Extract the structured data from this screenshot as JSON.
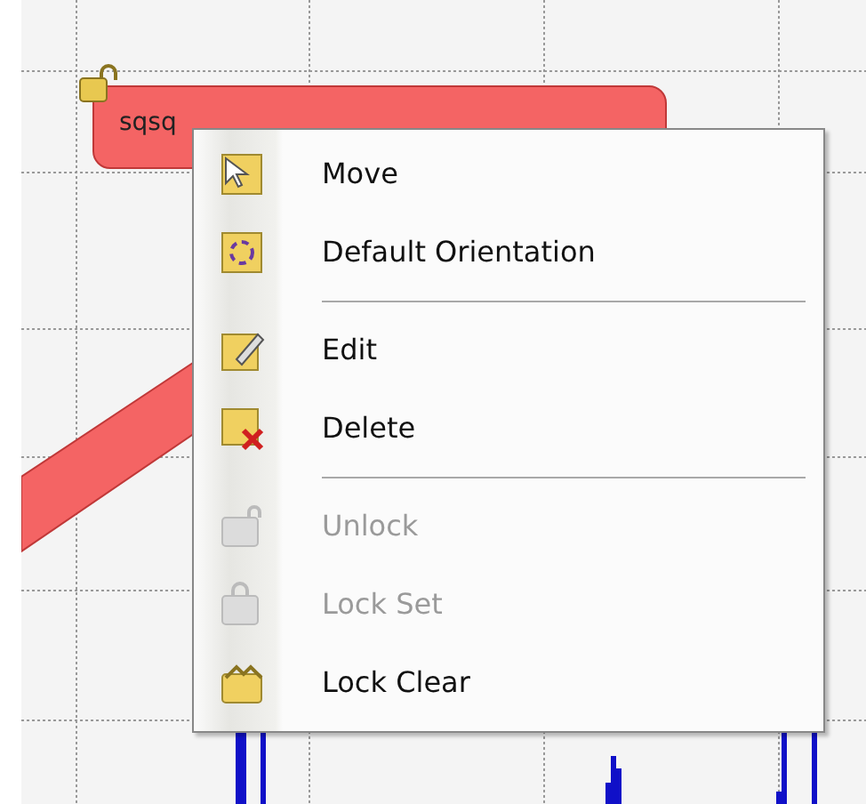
{
  "node": {
    "label": "sqsq",
    "locked": true
  },
  "context_menu": {
    "items": [
      {
        "kind": "item",
        "label": "Move",
        "disabled": false
      },
      {
        "kind": "item",
        "label": "Default Orientation",
        "disabled": false
      },
      {
        "kind": "separator"
      },
      {
        "kind": "item",
        "label": "Edit",
        "disabled": false
      },
      {
        "kind": "item",
        "label": "Delete",
        "disabled": false
      },
      {
        "kind": "separator"
      },
      {
        "kind": "item",
        "label": "Unlock",
        "disabled": true
      },
      {
        "kind": "item",
        "label": "Lock Set",
        "disabled": true
      },
      {
        "kind": "item",
        "label": "Lock Clear",
        "disabled": false
      }
    ]
  }
}
